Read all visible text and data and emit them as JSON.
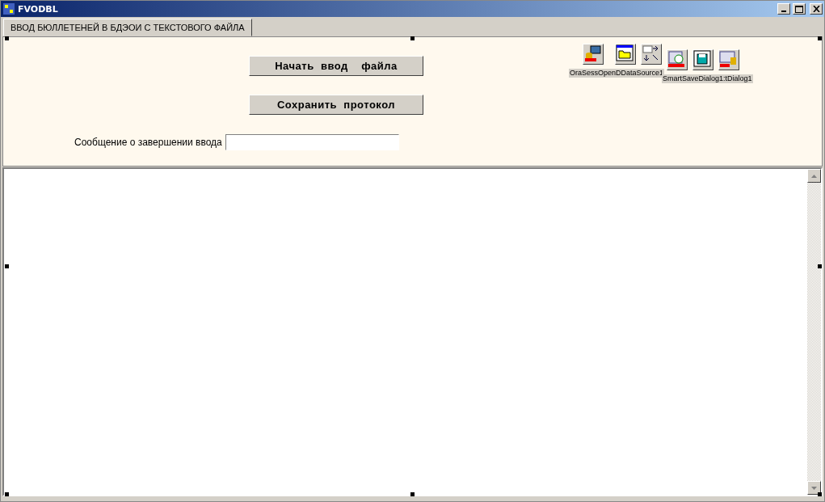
{
  "window": {
    "title": "FVODBL"
  },
  "tabs": [
    {
      "label": "ВВОД БЮЛЛЕТЕНЕЙ В  БДЭОИ  С ТЕКСТОВОГО ФАЙЛА",
      "selected": true
    }
  ],
  "buttons": [
    "Начать  ввод    файла",
    "Сохранить  протокол"
  ],
  "message_field": {
    "label": "Сообщение о завершении ввода"
  },
  "components": [
    {
      "kind": "session"
    },
    {
      "kind": "open"
    },
    {
      "kind": "datasource"
    },
    {
      "kind": "sql"
    },
    {
      "kind": "save"
    },
    {
      "kind": "table"
    }
  ],
  "component_captions": [
    "OraSessOpenDDataSource1",
    "SmartSaveDialog1:tDialog1"
  ]
}
